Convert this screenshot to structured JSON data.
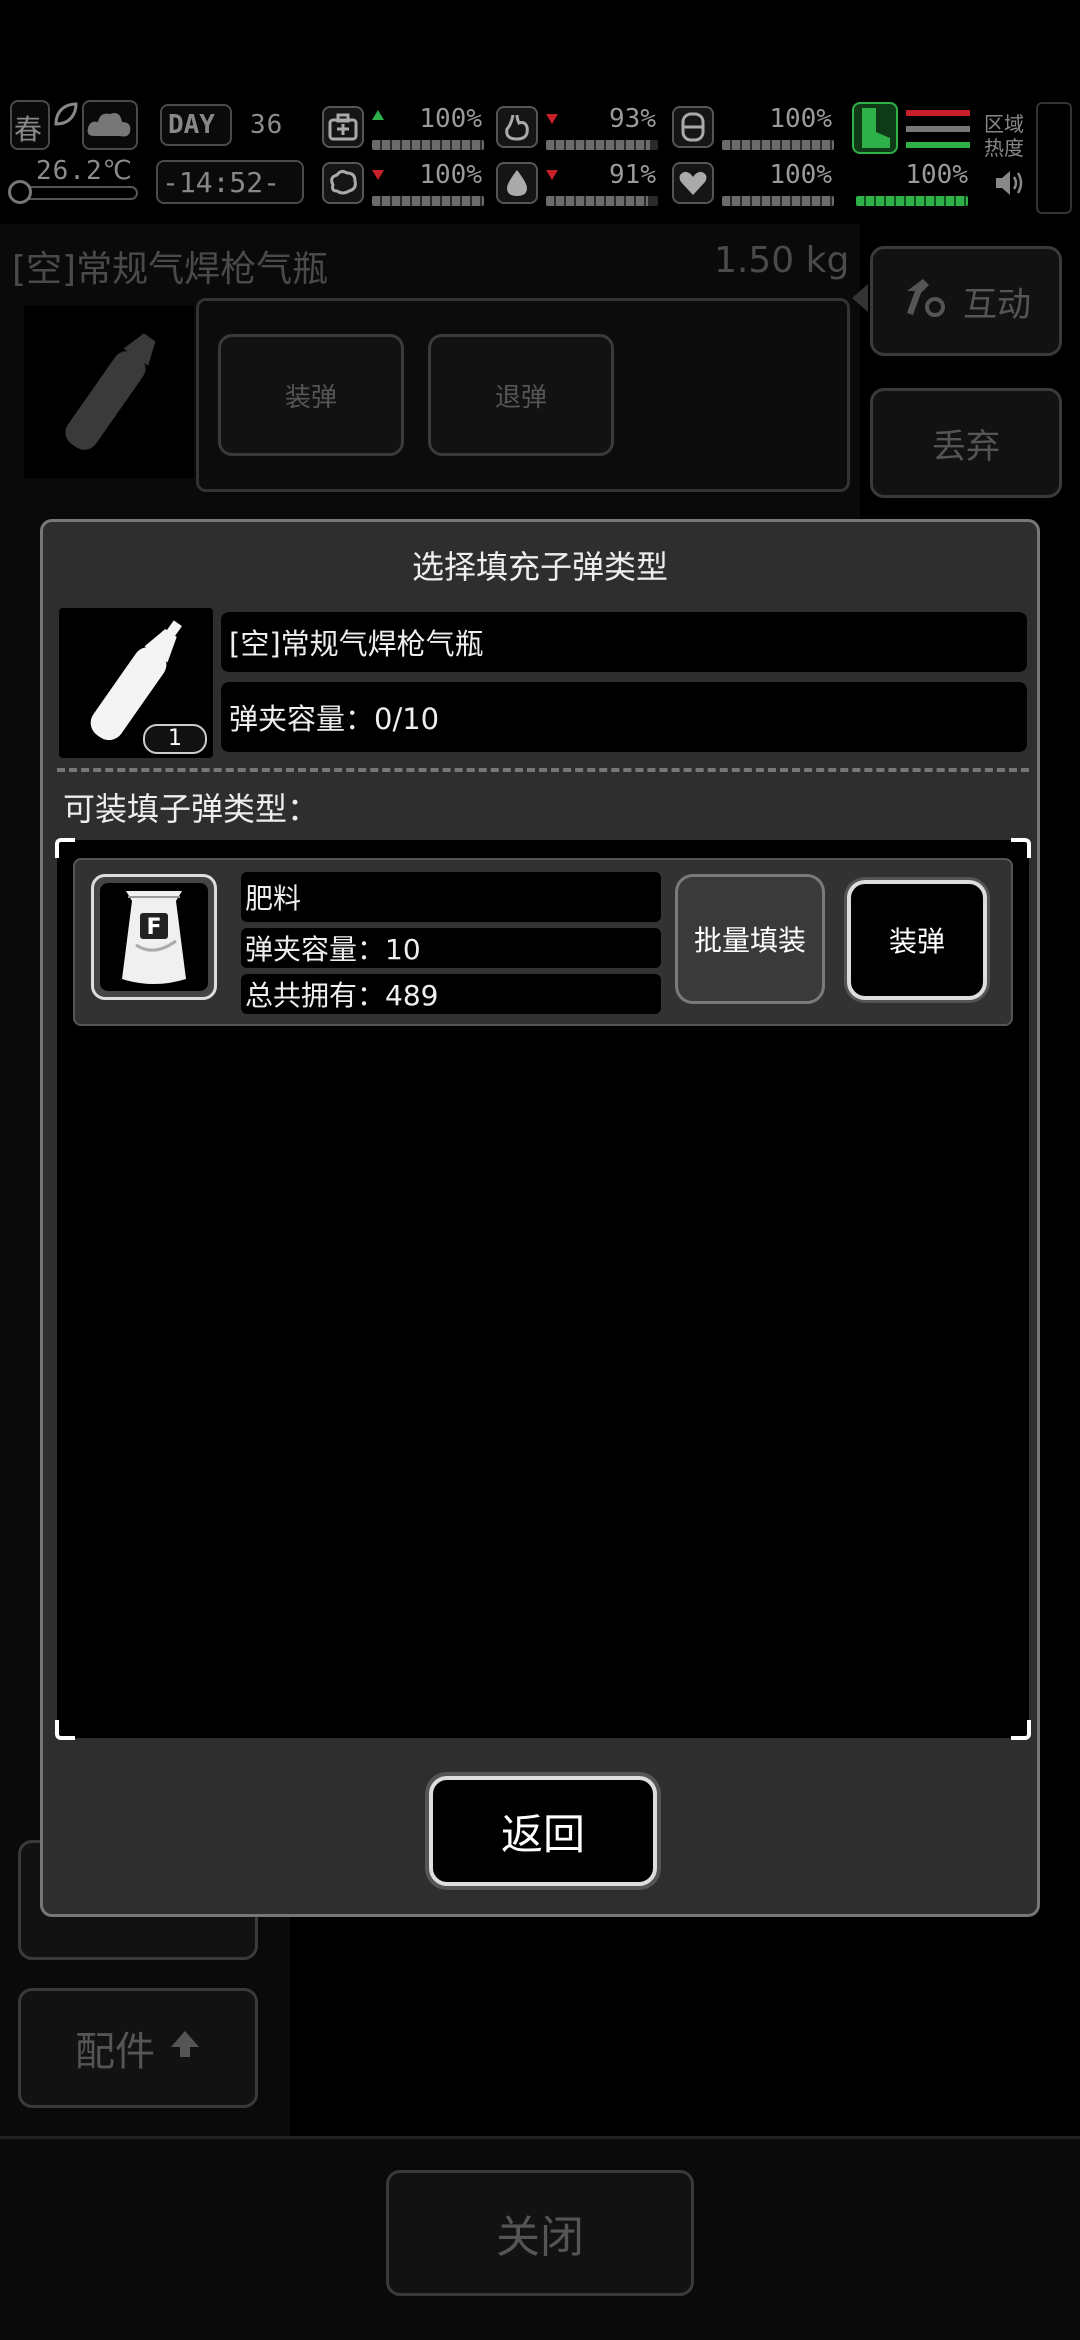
{
  "hud": {
    "season": "春",
    "temperature": "26.2℃",
    "day_label": "DAY",
    "day_number": "36",
    "time": "-14:52-",
    "stats": [
      {
        "icon": "medkit-icon",
        "value": "100%",
        "trend": "up",
        "level": 1.0
      },
      {
        "icon": "stomach-icon",
        "value": "93%",
        "trend": "down",
        "level": 0.93
      },
      {
        "icon": "cup-icon",
        "value": "100%",
        "trend": "none",
        "level": 1.0
      },
      {
        "icon": "brain-icon",
        "value": "100%",
        "trend": "down",
        "level": 1.0
      },
      {
        "icon": "water-drop-icon",
        "value": "91%",
        "trend": "down",
        "level": 0.91
      },
      {
        "icon": "heart-icon",
        "value": "100%",
        "trend": "none",
        "level": 1.0
      }
    ],
    "stamina_value": "100%",
    "stamina_level": 1.0,
    "zone_heat_label": "区域热度",
    "accent_green": "#2fb14a",
    "accent_red": "#c8202a"
  },
  "background": {
    "item_name": "[空]常规气焊枪气瓶",
    "item_weight": "1.50 kg",
    "load_label": "装弹",
    "unload_label": "退弹",
    "interact_label": "互动",
    "discard_label": "丢弃",
    "parts_label": "配件",
    "close_label": "关闭"
  },
  "modal": {
    "title": "选择填充子弹类型",
    "item_name": "[空]常规气焊枪气瓶",
    "item_count": "1",
    "capacity_label": "弹夹容量：0/10",
    "section_label": "可装填子弹类型：",
    "ammo": [
      {
        "name": "肥料",
        "capacity": "弹夹容量：10",
        "owned": "总共拥有：489",
        "batch_label": "批量填装",
        "load_label": "装弹",
        "icon_letter": "F"
      }
    ],
    "back_label": "返回"
  }
}
